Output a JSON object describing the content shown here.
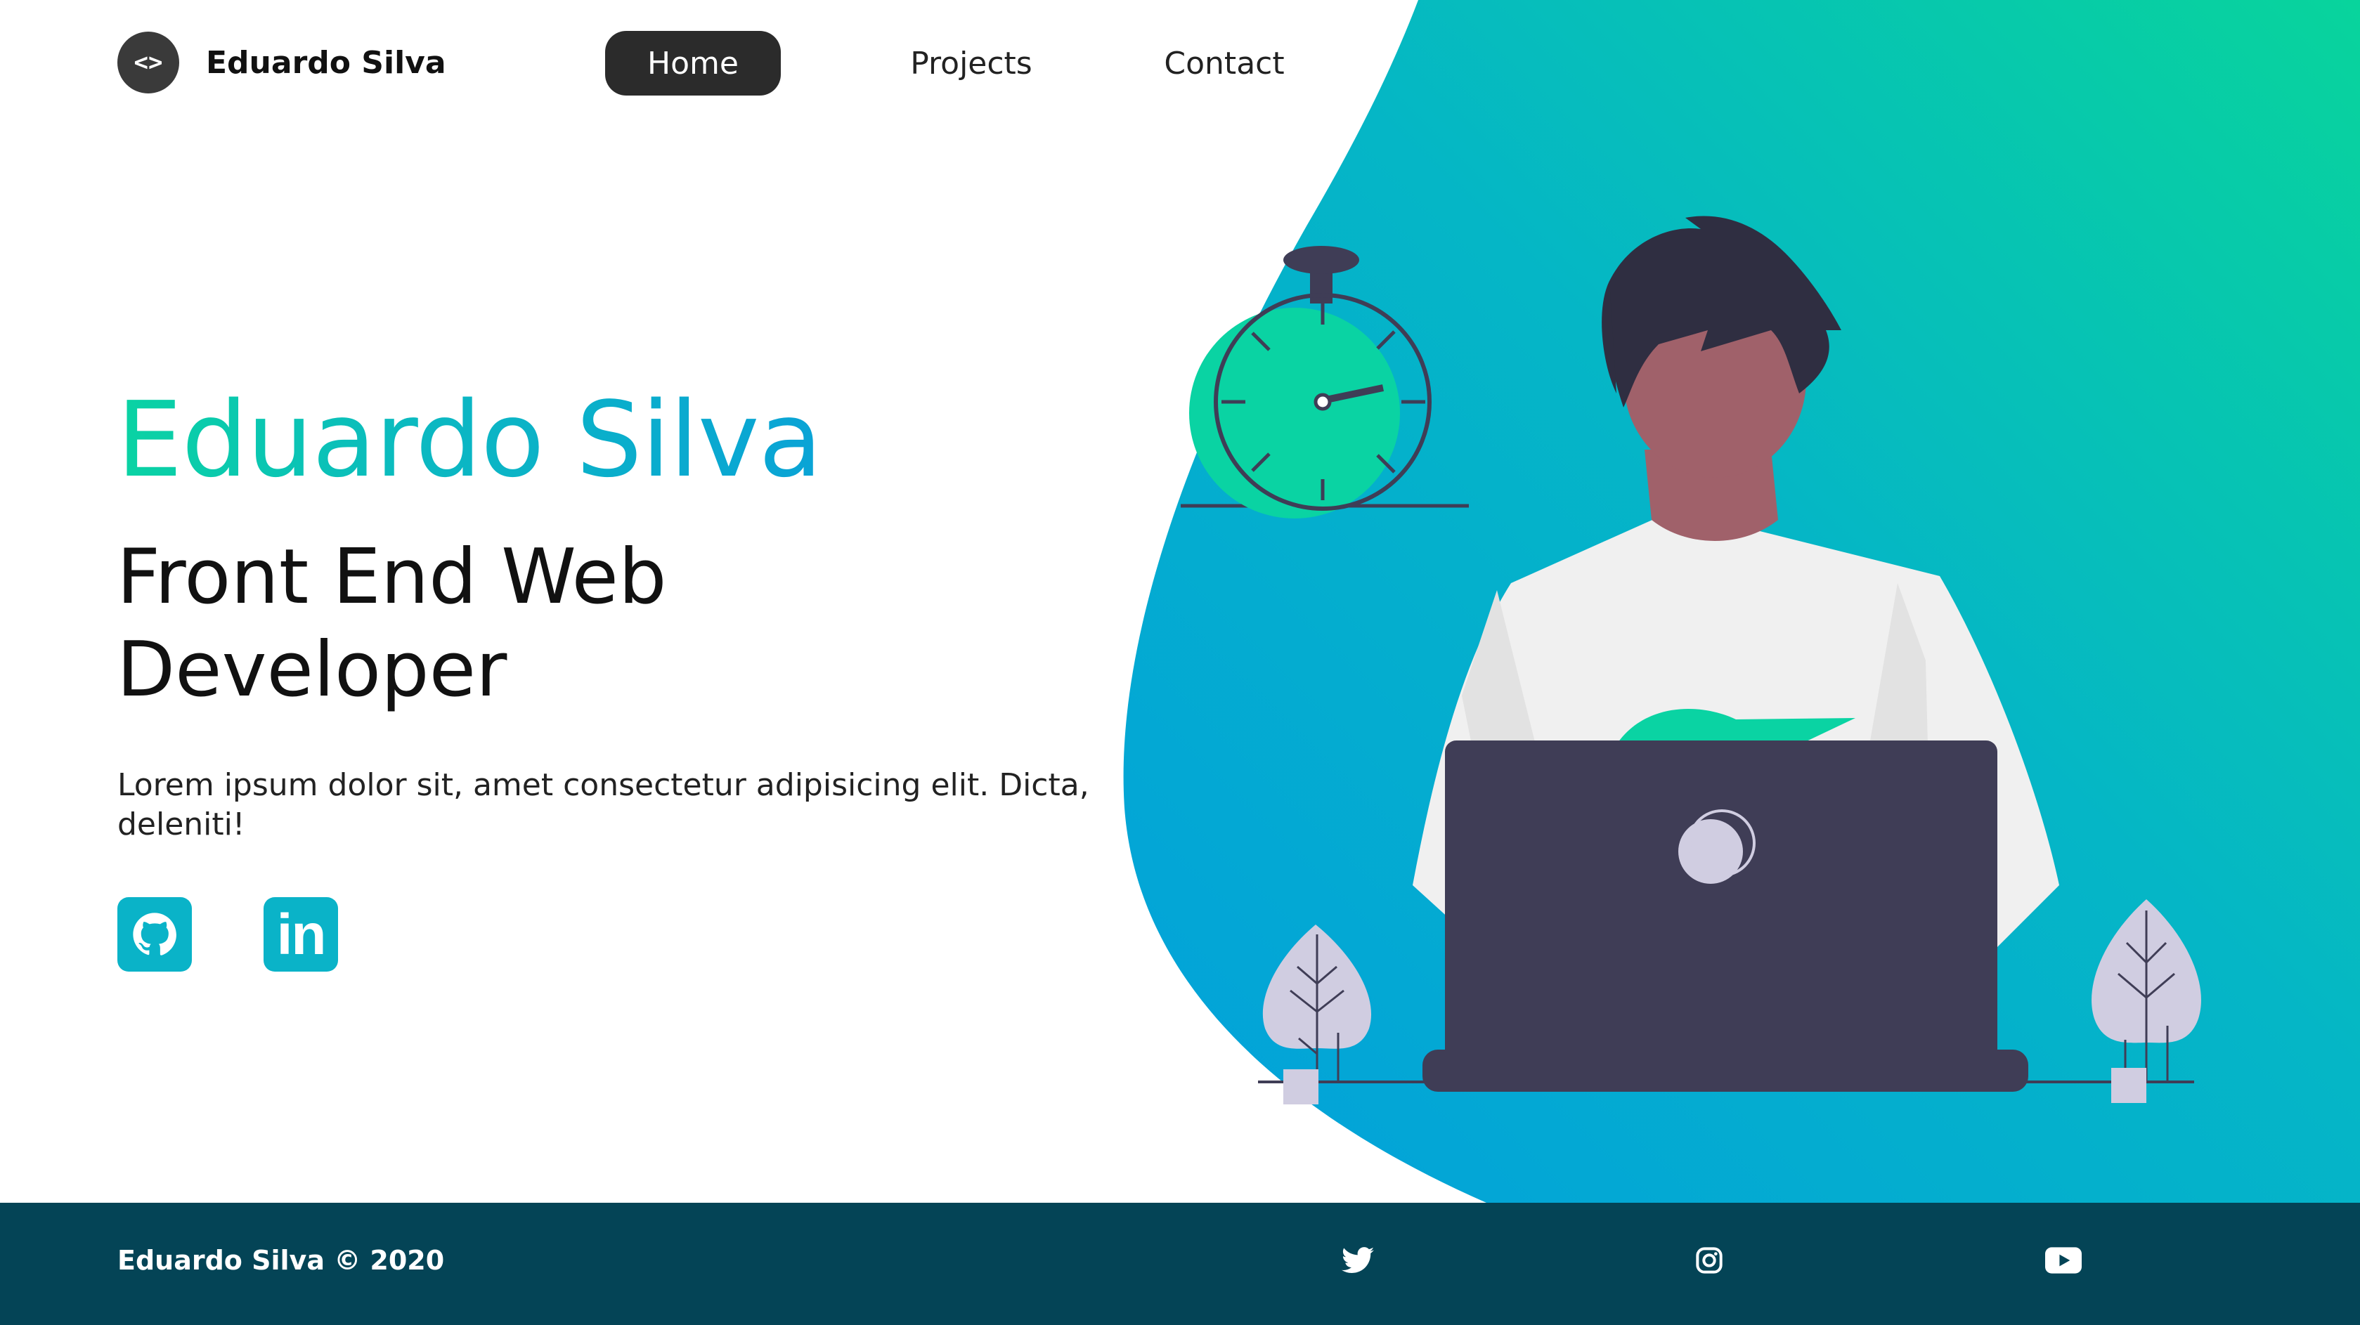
{
  "colors": {
    "accent_green": "#0ad3a3",
    "accent_blue": "#0aa3d6",
    "footer_bg": "#044456",
    "nav_active_bg": "#2b2b2b",
    "social_bg": "#0ab3c8"
  },
  "header": {
    "logo_glyph": "<>",
    "brand_name": "Eduardo Silva",
    "nav": [
      {
        "label": "Home",
        "active": true
      },
      {
        "label": "Projects",
        "active": false
      },
      {
        "label": "Contact",
        "active": false
      }
    ]
  },
  "hero": {
    "name": "Eduardo Silva",
    "role": "Front End Web Developer",
    "description": "Lorem ipsum dolor sit, amet consectetur adipisicing elit. Dicta, deleniti!",
    "socials": [
      {
        "icon": "github-icon"
      },
      {
        "icon": "linkedin-icon",
        "glyph": "in"
      }
    ],
    "illustration": "developer-at-laptop-with-stopwatch-and-plants"
  },
  "footer": {
    "copyright": "Eduardo Silva © 2020",
    "icons": [
      "twitter-icon",
      "instagram-icon",
      "youtube-icon"
    ]
  }
}
